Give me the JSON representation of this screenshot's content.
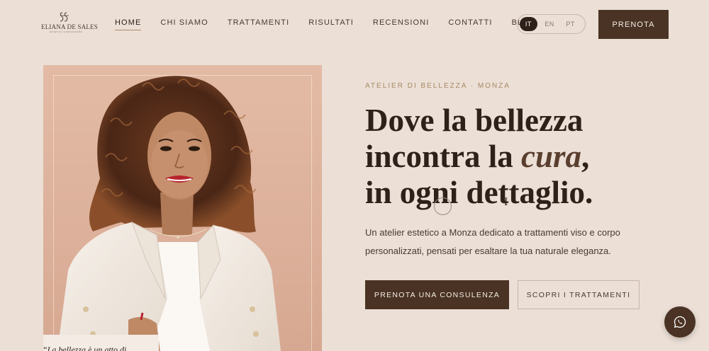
{
  "brand": {
    "name": "ELIANA DE SALES",
    "tagline": "ESTETICA E BENESSERE"
  },
  "nav": [
    {
      "label": "HOME",
      "active": true
    },
    {
      "label": "CHI SIAMO"
    },
    {
      "label": "TRATTAMENTI"
    },
    {
      "label": "RISULTATI"
    },
    {
      "label": "RECENSIONI"
    },
    {
      "label": "CONTATTI"
    },
    {
      "label": "BLOG"
    }
  ],
  "languages": [
    {
      "label": "IT",
      "active": true
    },
    {
      "label": "EN"
    },
    {
      "label": "PT"
    }
  ],
  "header_cta": "PRENOTA",
  "hero": {
    "eyebrow": "ATELIER DI BELLEZZA · MONZA",
    "headline_line1": "Dove la bellezza",
    "headline_line2_pre": "incontra la ",
    "headline_line2_accent": "cura",
    "headline_line2_post": ",",
    "headline_line3": "in ogni dettaglio.",
    "subtext": "Un atelier estetico a Monza dedicato a trattamenti viso e corpo personalizzati, pensati per esaltare la tua naturale eleganza.",
    "primary_cta": "PRENOTA UNA CONSULENZA",
    "secondary_cta": "SCOPRI I TRATTAMENTI",
    "quote_card": "“La bellezza è un atto di"
  },
  "colors": {
    "background": "#ebdfd6",
    "brand_dark": "#4a3324",
    "accent_gold": "#a98a66",
    "text": "#2e211a"
  },
  "icons": {
    "whatsapp": "whatsapp-icon",
    "logo": "logo-monogram-icon"
  }
}
